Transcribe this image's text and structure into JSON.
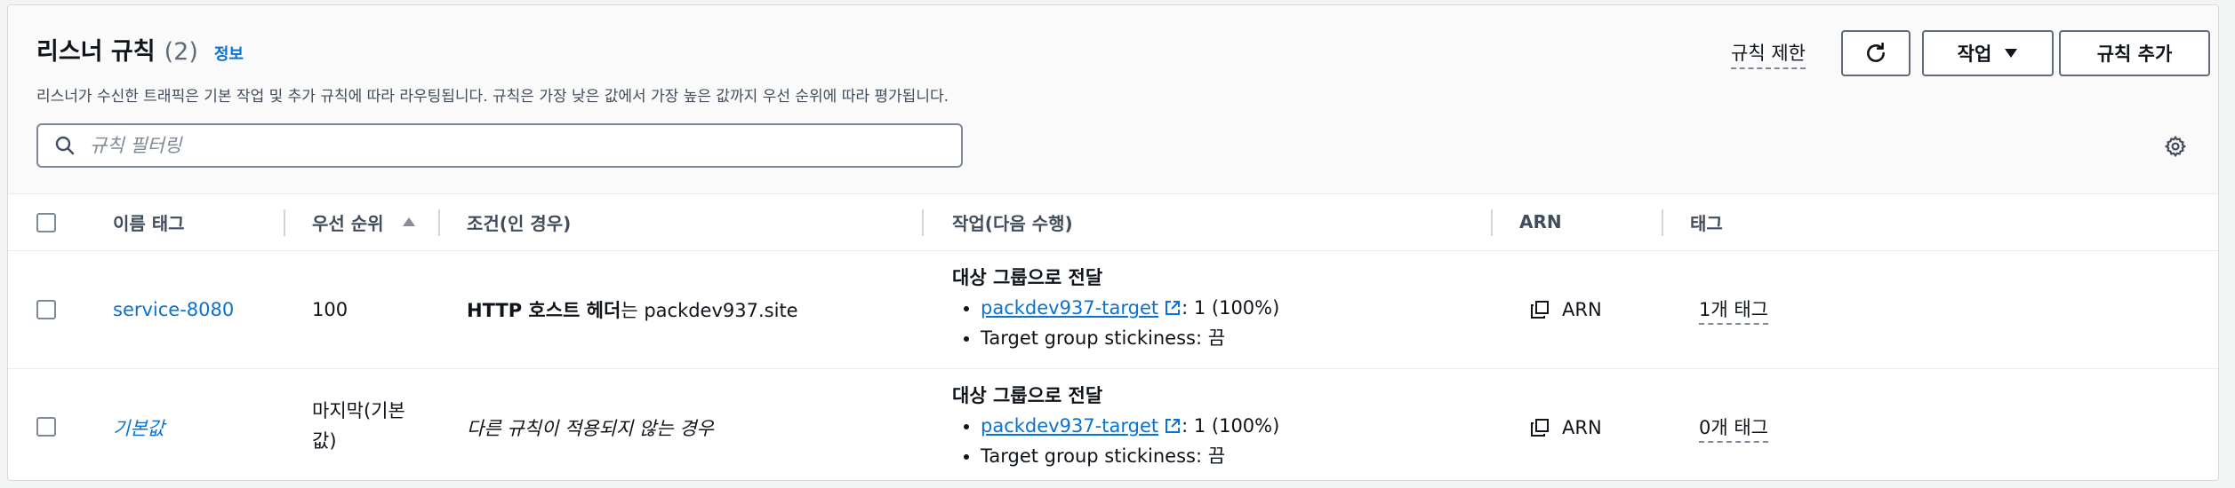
{
  "header": {
    "title": "리스너 규칙",
    "count": "(2)",
    "info": "정보",
    "description": "리스너가 수신한 트래픽은 기본 작업 및 추가 규칙에 따라 라우팅됩니다. 규칙은 가장 낮은 값에서 가장 높은 값까지 우선 순위에 따라 평가됩니다.",
    "limits_label": "규칙 제한",
    "actions_label": "작업",
    "add_rule_label": "규칙 추가"
  },
  "search": {
    "placeholder": "규칙 필터링",
    "value": ""
  },
  "table": {
    "columns": {
      "name_tag": "이름 태그",
      "priority": "우선 순위",
      "conditions": "조건(인 경우)",
      "actions": "작업(다음 수행)",
      "arn": "ARN",
      "tags": "태그"
    },
    "sort": {
      "column": "priority",
      "direction": "ascending"
    },
    "rows": [
      {
        "name": "service-8080",
        "priority": "100",
        "condition_bold": "HTTP 호스트 헤더",
        "condition_rest": "는 packdev937.site",
        "action_title": "대상 그룹으로 전달",
        "target_link": "packdev937-target",
        "target_weight": ": 1 (100%)",
        "stickiness": "Target group stickiness: 끔",
        "arn": "ARN",
        "tags": "1개 태그"
      },
      {
        "name": "기본값",
        "priority": "마지막(기본 값)",
        "priority_line1": "마지막(기본",
        "priority_line2": "값)",
        "condition": "다른 규칙이 적용되지 않는 경우",
        "action_title": "대상 그룹으로 전달",
        "target_link": "packdev937-target",
        "target_weight": ": 1 (100%)",
        "stickiness": "Target group stickiness: 끔",
        "arn": "ARN",
        "tags": "0개 태그"
      }
    ]
  },
  "icons": {
    "refresh": "refresh-icon",
    "caret": "caret-down-icon",
    "search": "search-icon",
    "settings": "gear-icon",
    "external": "external-link-icon",
    "copy": "copy-icon",
    "sort": "sort-ascending-icon"
  },
  "colors": {
    "link": "#0972d3",
    "text": "#0f141a",
    "border": "#7d8998"
  }
}
